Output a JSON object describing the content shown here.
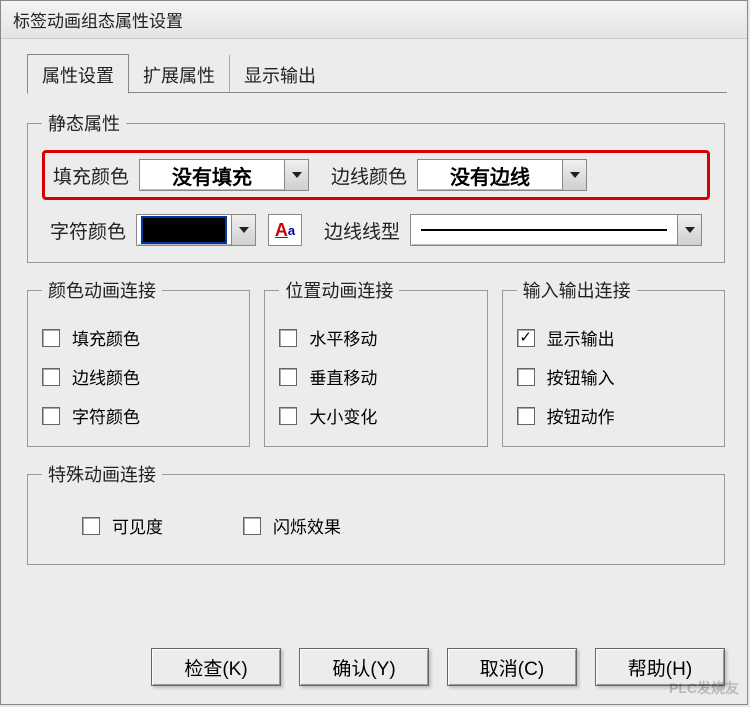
{
  "window": {
    "title": "标签动画组态属性设置"
  },
  "tabs": {
    "t1": "属性设置",
    "t2": "扩展属性",
    "t3": "显示输出"
  },
  "static": {
    "legend": "静态属性",
    "fill_label": "填充颜色",
    "fill_value": "没有填充",
    "border_color_label": "边线颜色",
    "border_color_value": "没有边线",
    "char_color_label": "字符颜色",
    "border_style_label": "边线线型"
  },
  "groups": {
    "color": {
      "legend": "颜色动画连接",
      "c1": "填充颜色",
      "c2": "边线颜色",
      "c3": "字符颜色"
    },
    "position": {
      "legend": "位置动画连接",
      "c1": "水平移动",
      "c2": "垂直移动",
      "c3": "大小变化"
    },
    "io": {
      "legend": "输入输出连接",
      "c1": "显示输出",
      "c2": "按钮输入",
      "c3": "按钮动作"
    },
    "special": {
      "legend": "特殊动画连接",
      "c1": "可见度",
      "c2": "闪烁效果"
    }
  },
  "buttons": {
    "check": "检查(K)",
    "ok": "确认(Y)",
    "cancel": "取消(C)",
    "help": "帮助(H)"
  },
  "watermark": "PLC发烧友"
}
